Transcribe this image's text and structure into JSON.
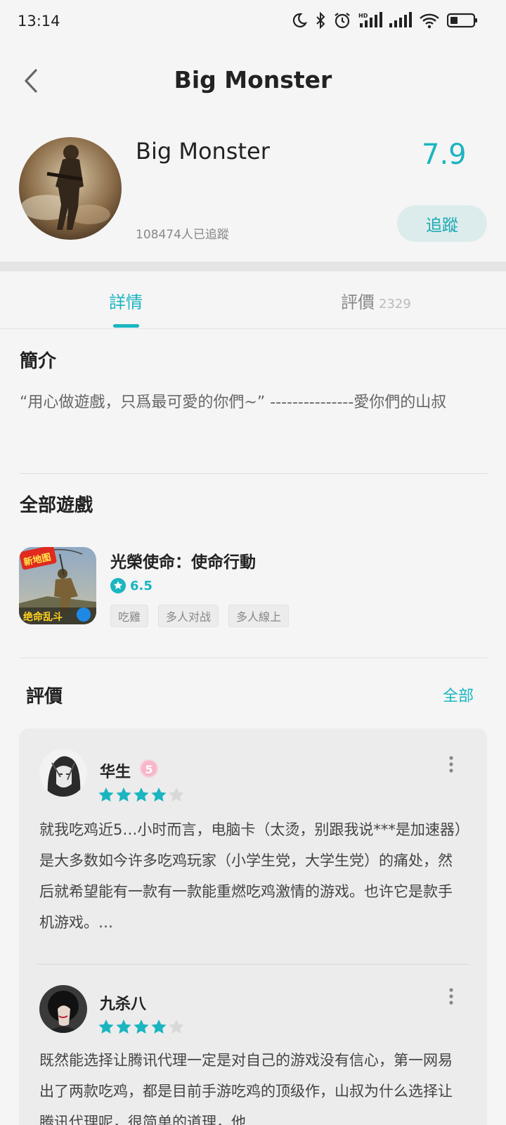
{
  "status_bar": {
    "time": "13:14",
    "icons": [
      "moon-icon",
      "bluetooth-icon",
      "alarm-icon",
      "hd-signal-icon",
      "signal-icon",
      "wifi-icon",
      "battery-icon"
    ]
  },
  "header": {
    "title": "Big Monster",
    "back_icon": "chevron-left-icon"
  },
  "developer": {
    "name": "Big Monster",
    "followers": "108474人已追蹤",
    "score": "7.9",
    "follow_label": "追蹤"
  },
  "tabs": [
    {
      "label": "詳情",
      "active": true
    },
    {
      "label": "評價",
      "count": "2329",
      "active": false
    }
  ],
  "intro": {
    "title": "簡介",
    "text": "“用心做遊戲，只爲最可愛的你們~” ---------------愛你們的山叔"
  },
  "games": {
    "title": "全部遊戲",
    "items": [
      {
        "name": "光榮使命：使命行動",
        "rating": "6.5",
        "tags": [
          "吃雞",
          "多人对战",
          "多人線上"
        ],
        "icon_badge": "新地图",
        "icon_caption": "绝命乱斗"
      }
    ]
  },
  "reviews": {
    "title": "評價",
    "all_label": "全部",
    "items": [
      {
        "user": "华生",
        "badge": "5",
        "stars": 4,
        "text": "就我吃鸡近5…小时而言，电脑卡（太烫，别跟我说***是加速器）是大多数如今许多吃鸡玩家（小学生党，大学生党）的痛处，然后就希望能有一款有一款能重燃吃鸡激情的游戏。也许它是款手机游戏。…"
      },
      {
        "user": "九杀八",
        "stars": 4,
        "text": "既然能选择让腾讯代理一定是对自己的游戏没有信心，第一网易出了两款吃鸡，都是目前手游吃鸡的顶级作，山叔为什么选择让腾讯代理呢，很简单的道理，他"
      }
    ]
  },
  "colors": {
    "accent": "#1bb5c0",
    "background": "#f5f5f5",
    "card": "#ececec",
    "star_empty": "#d8d8d8"
  }
}
